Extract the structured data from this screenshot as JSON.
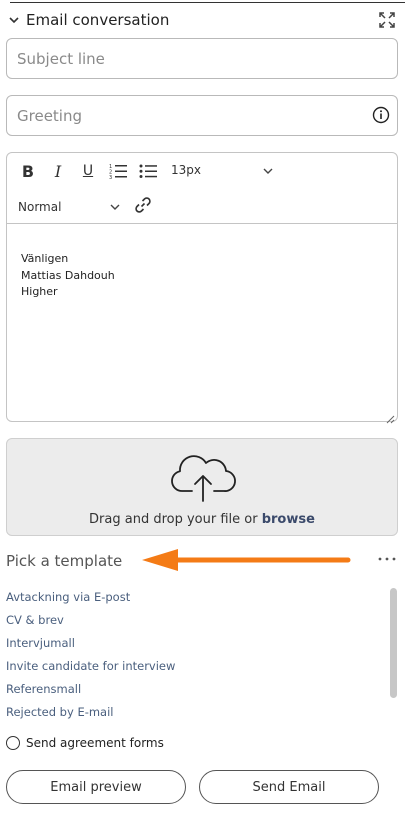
{
  "header": {
    "title": "Email conversation",
    "collapse_icon": "chevron-down-icon",
    "expand_icon": "fullscreen-expand-icon"
  },
  "subject": {
    "placeholder": "Subject line",
    "value": ""
  },
  "greeting": {
    "placeholder": "Greeting",
    "value": "",
    "info_icon": "info-icon"
  },
  "editor": {
    "toolbar": {
      "bold": "B",
      "italic": "I",
      "underline": "U",
      "font_size": "13px",
      "format": "Normal"
    },
    "body_lines": [
      "Vänligen",
      "Mattias Dahdouh",
      "Higher"
    ]
  },
  "upload": {
    "icon": "cloud-upload-icon",
    "text": "Drag and drop your file or ",
    "browse": "browse"
  },
  "templates": {
    "title": "Pick a template",
    "items": [
      "Avtackning via E-post",
      "CV & brev",
      "Intervjumall",
      "Invite candidate for interview",
      "Referensmall",
      "Rejected by E-mail"
    ]
  },
  "agreement": {
    "label": "Send agreement forms",
    "checked": false
  },
  "buttons": {
    "preview": "Email preview",
    "send": "Send Email"
  },
  "colors": {
    "annotation_arrow": "#f47b16",
    "template_link": "#4a5f7e",
    "dropzone_bg": "#ececec"
  }
}
